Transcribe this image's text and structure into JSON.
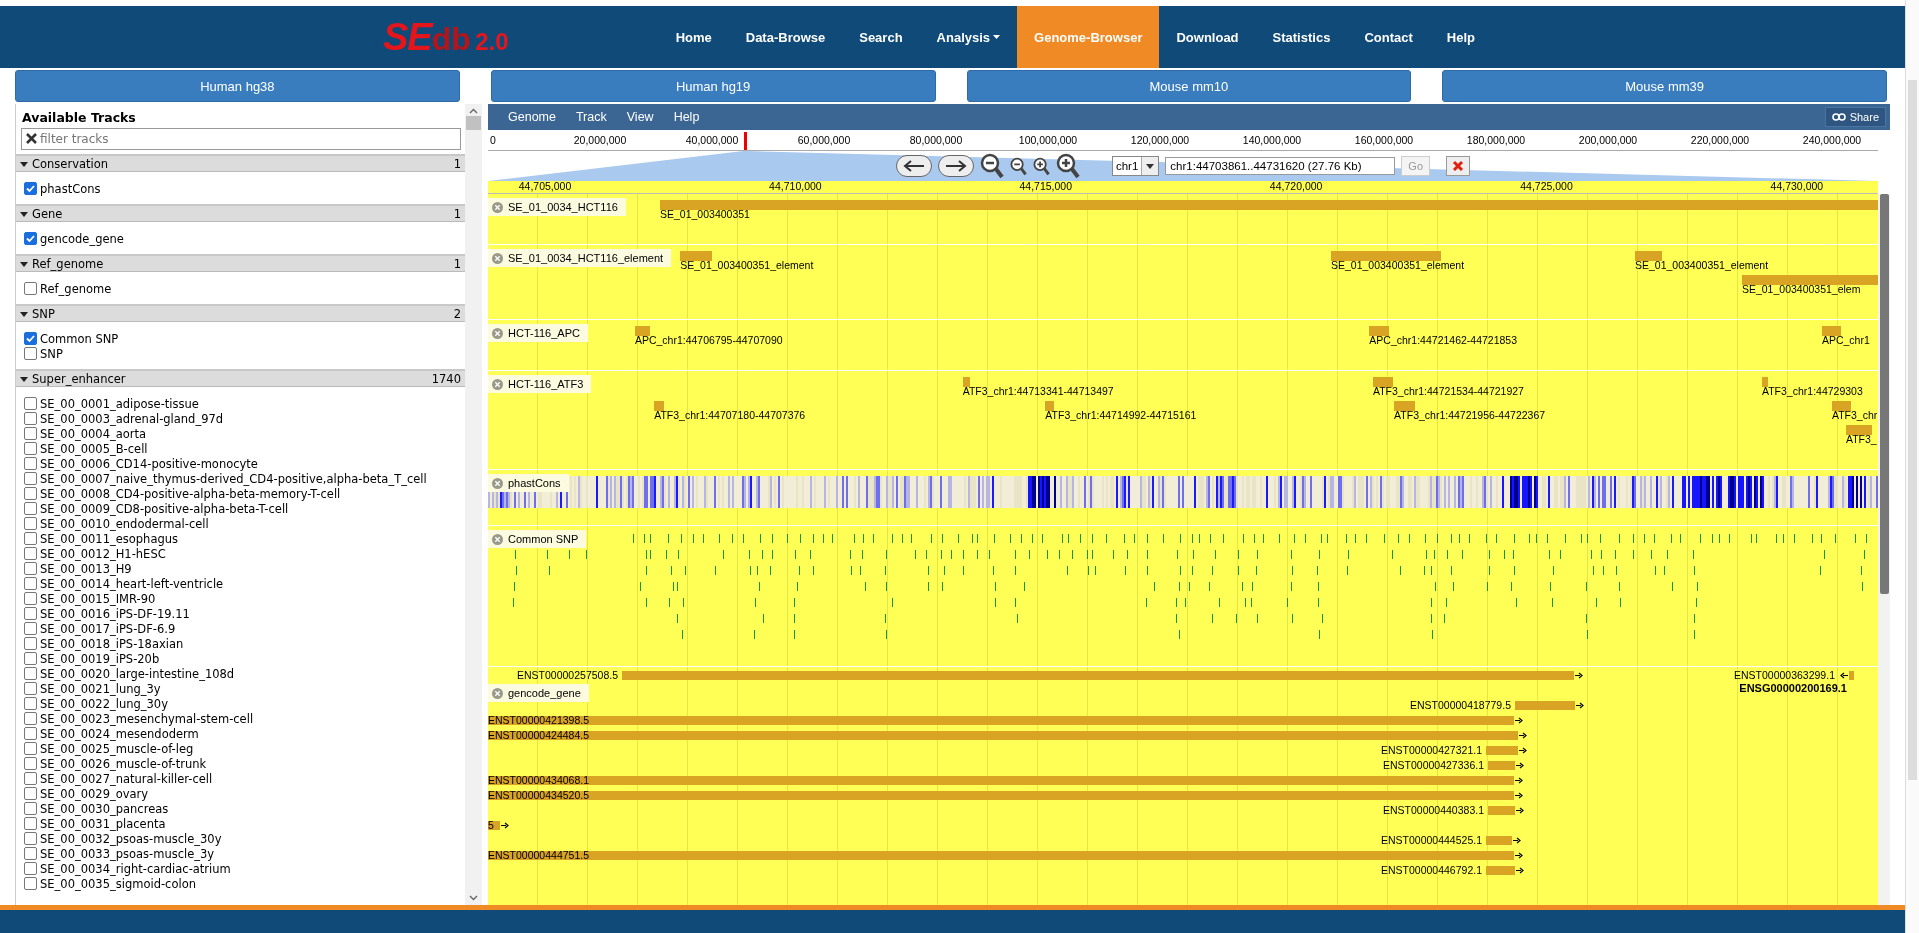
{
  "header": {
    "logo": {
      "main": "SE",
      "sub": "db",
      "version": "2.0"
    },
    "nav": [
      {
        "label": "Home",
        "selected": false,
        "dropdown": false
      },
      {
        "label": "Data-Browse",
        "selected": false,
        "dropdown": false
      },
      {
        "label": "Search",
        "selected": false,
        "dropdown": false
      },
      {
        "label": "Analysis",
        "selected": false,
        "dropdown": true
      },
      {
        "label": "Genome-Browser",
        "selected": true,
        "dropdown": false
      },
      {
        "label": "Download",
        "selected": false,
        "dropdown": false
      },
      {
        "label": "Statistics",
        "selected": false,
        "dropdown": false
      },
      {
        "label": "Contact",
        "selected": false,
        "dropdown": false
      },
      {
        "label": "Help",
        "selected": false,
        "dropdown": false
      }
    ]
  },
  "genome_tabs": [
    {
      "label": "Human hg38"
    },
    {
      "label": "Human hg19"
    },
    {
      "label": "Mouse mm10"
    },
    {
      "label": "Mouse mm39"
    }
  ],
  "sidebar": {
    "title": "Available Tracks",
    "filter": {
      "placeholder": "filter tracks"
    },
    "categories": [
      {
        "name": "Conservation",
        "count": "1",
        "expanded": true,
        "items": [
          {
            "label": "phastCons",
            "checked": true
          }
        ]
      },
      {
        "name": "Gene",
        "count": "1",
        "expanded": true,
        "items": [
          {
            "label": "gencode_gene",
            "checked": true
          }
        ]
      },
      {
        "name": "Ref_genome",
        "count": "1",
        "expanded": true,
        "items": [
          {
            "label": "Ref_genome",
            "checked": false
          }
        ]
      },
      {
        "name": "SNP",
        "count": "2",
        "expanded": true,
        "items": [
          {
            "label": "Common SNP",
            "checked": true
          },
          {
            "label": "SNP",
            "checked": false
          }
        ]
      },
      {
        "name": "Super_enhancer",
        "count": "1740",
        "expanded": true,
        "items": [
          {
            "label": "SE_00_0001_adipose-tissue",
            "checked": false
          },
          {
            "label": "SE_00_0003_adrenal-gland_97d",
            "checked": false
          },
          {
            "label": "SE_00_0004_aorta",
            "checked": false
          },
          {
            "label": "SE_00_0005_B-cell",
            "checked": false
          },
          {
            "label": "SE_00_0006_CD14-positive-monocyte",
            "checked": false
          },
          {
            "label": "SE_00_0007_naive_thymus-derived_CD4-positive,alpha-beta_T_cell",
            "checked": false
          },
          {
            "label": "SE_00_0008_CD4-positive-alpha-beta-memory-T-cell",
            "checked": false
          },
          {
            "label": "SE_00_0009_CD8-positive-alpha-beta-T-cell",
            "checked": false
          },
          {
            "label": "SE_00_0010_endodermal-cell",
            "checked": false
          },
          {
            "label": "SE_00_0011_esophagus",
            "checked": false
          },
          {
            "label": "SE_00_0012_H1-hESC",
            "checked": false
          },
          {
            "label": "SE_00_0013_H9",
            "checked": false
          },
          {
            "label": "SE_00_0014_heart-left-ventricle",
            "checked": false
          },
          {
            "label": "SE_00_0015_IMR-90",
            "checked": false
          },
          {
            "label": "SE_00_0016_iPS-DF-19.11",
            "checked": false
          },
          {
            "label": "SE_00_0017_iPS-DF-6.9",
            "checked": false
          },
          {
            "label": "SE_00_0018_iPS-18axian",
            "checked": false
          },
          {
            "label": "SE_00_0019_iPS-20b",
            "checked": false
          },
          {
            "label": "SE_00_0020_large-intestine_108d",
            "checked": false
          },
          {
            "label": "SE_00_0021_lung_3y",
            "checked": false
          },
          {
            "label": "SE_00_0022_lung_30y",
            "checked": false
          },
          {
            "label": "SE_00_0023_mesenchymal-stem-cell",
            "checked": false
          },
          {
            "label": "SE_00_0024_mesendoderm",
            "checked": false
          },
          {
            "label": "SE_00_0025_muscle-of-leg",
            "checked": false
          },
          {
            "label": "SE_00_0026_muscle-of-trunk",
            "checked": false
          },
          {
            "label": "SE_00_0027_natural-killer-cell",
            "checked": false
          },
          {
            "label": "SE_00_0029_ovary",
            "checked": false
          },
          {
            "label": "SE_00_0030_pancreas",
            "checked": false
          },
          {
            "label": "SE_00_0031_placenta",
            "checked": false
          },
          {
            "label": "SE_00_0032_psoas-muscle_30y",
            "checked": false
          },
          {
            "label": "SE_00_0033_psoas-muscle_3y",
            "checked": false
          },
          {
            "label": "SE_00_0034_right-cardiac-atrium",
            "checked": false
          },
          {
            "label": "SE_00_0035_sigmoid-colon",
            "checked": false
          }
        ]
      }
    ]
  },
  "browser": {
    "menu": [
      "Genome",
      "Track",
      "View",
      "Help"
    ],
    "share": "Share",
    "overview": {
      "ticks": [
        "0",
        "20,000,000",
        "40,000,000",
        "60,000,000",
        "80,000,000",
        "100,000,000",
        "120,000,000",
        "140,000,000",
        "160,000,000",
        "180,000,000",
        "200,000,000",
        "220,000,000",
        "240,000,000"
      ]
    },
    "toolbar": {
      "chromosome": "chr1",
      "location": "chr1:44703861..44731620 (27.76 Kb)",
      "go": {
        "label": "Go",
        "disabled": true
      }
    },
    "ruler": [
      "44,705,000",
      "44,710,000",
      "44,715,000",
      "44,720,000",
      "44,725,000",
      "44,730,000"
    ],
    "tracks": [
      {
        "kind": "features",
        "name": "SE_01_0034_HCT116",
        "features": [
          {
            "label": "SE_01_003400351"
          }
        ]
      },
      {
        "kind": "features",
        "name": "SE_01_0034_HCT116_element",
        "features": [
          {
            "label": "SE_01_003400351_element"
          },
          {
            "label": "SE_01_003400351_element"
          },
          {
            "label": "SE_01_003400351_element"
          },
          {
            "label": "SE_01_003400351_elem"
          }
        ]
      },
      {
        "kind": "features",
        "name": "HCT-116_APC",
        "features": [
          {
            "label": "APC_chr1:44706795-44707090"
          },
          {
            "label": "APC_chr1:44721462-44721853"
          },
          {
            "label": "APC_chr1"
          }
        ]
      },
      {
        "kind": "features",
        "name": "HCT-116_ATF3",
        "features": [
          {
            "label": "ATF3_chr1:44713341-44713497"
          },
          {
            "label": "ATF3_chr1:44721534-44721927"
          },
          {
            "label": "ATF3_chr1:44729303"
          },
          {
            "label": "ATF3_chr1:44707180-44707376"
          },
          {
            "label": "ATF3_chr1:44714992-44715161"
          },
          {
            "label": "ATF3_chr1:44721956-44722367"
          },
          {
            "label": "ATF3_chr"
          },
          {
            "label": "ATF3_"
          }
        ]
      },
      {
        "kind": "conservation",
        "name": "phastCons"
      },
      {
        "kind": "snp",
        "name": "Common SNP"
      },
      {
        "kind": "genes",
        "name": "gencode_gene",
        "features": [
          {
            "label": "ENST00000257508.5",
            "reverse": false
          },
          {
            "label": "ENST00000363299.1",
            "reverse": true,
            "gene": "ENSG00000200169.1"
          },
          {
            "label": "ENST00000418779.5",
            "reverse": false
          },
          {
            "label": "ENST00000421398.5",
            "reverse": false
          },
          {
            "label": "ENST00000424484.5",
            "reverse": false
          },
          {
            "label": "ENST00000427321.1",
            "reverse": false
          },
          {
            "label": "ENST00000427336.1",
            "reverse": false
          },
          {
            "label": "ENST00000434068.1",
            "reverse": false
          },
          {
            "label": "ENST00000434520.5",
            "reverse": false
          },
          {
            "label": "ENST00000440383.1",
            "reverse": false
          },
          {
            "label": "5",
            "reverse": false
          },
          {
            "label": "ENST00000444525.1",
            "reverse": false
          },
          {
            "label": "ENST00000444751.5",
            "reverse": false
          },
          {
            "label": "ENST00000446792.1",
            "reverse": false
          }
        ]
      }
    ]
  }
}
